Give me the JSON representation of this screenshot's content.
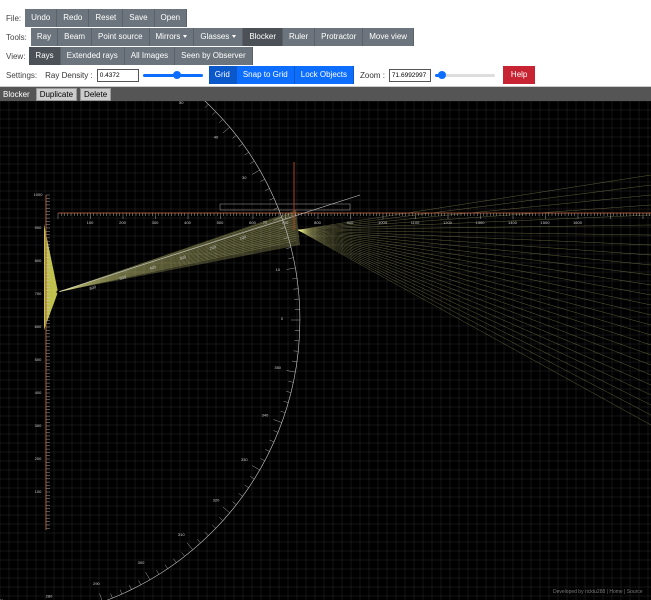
{
  "file_row": {
    "label": "File:",
    "buttons": [
      "Undo",
      "Redo",
      "Reset",
      "Save",
      "Open"
    ]
  },
  "tools_row": {
    "label": "Tools:",
    "ray": "Ray",
    "beam": "Beam",
    "point_source": "Point source",
    "mirrors": "Mirrors",
    "glasses": "Glasses",
    "blocker": "Blocker",
    "ruler": "Ruler",
    "protractor": "Protractor",
    "move_view": "Move view"
  },
  "view_row": {
    "label": "View:",
    "rays": "Rays",
    "extended_rays": "Extended rays",
    "all_images": "All Images",
    "seen_by_observer": "Seen by Observer"
  },
  "settings_row": {
    "label": "Settings:",
    "ray_density_label": "Ray Density :",
    "ray_density_value": "0.4372",
    "grid": "Grid",
    "snap_to_grid": "Snap to Grid",
    "lock_objects": "Lock Objects",
    "zoom_label": "Zoom :",
    "zoom_value": "71.6992997",
    "help": "Help"
  },
  "object_bar": {
    "name": "Blocker",
    "duplicate": "Duplicate",
    "delete": "Delete"
  },
  "footer": "Developed by ricktu288 | Home | Source",
  "ruler": {
    "ticks": [
      "100",
      "200",
      "300",
      "400",
      "500",
      "600",
      "700",
      "800",
      "900",
      "1000",
      "1100",
      "1200",
      "1300",
      "1400",
      "1500",
      "1600"
    ]
  },
  "vruler": {
    "ticks": [
      "1000",
      "900",
      "800",
      "700",
      "600",
      "500",
      "400",
      "300",
      "200",
      "100"
    ]
  },
  "diag_ruler": {
    "ticks": [
      "600",
      "500",
      "400",
      "300",
      "200",
      "100"
    ]
  },
  "protractor_labels": [
    "90",
    "80",
    "70",
    "60",
    "50",
    "40",
    "30",
    "20",
    "10",
    "0",
    "350",
    "340",
    "330",
    "320",
    "310",
    "300",
    "290",
    "280",
    "270",
    "260",
    "250"
  ],
  "colors": {
    "ray": "#ffff99",
    "grid": "#2a2a2a",
    "ruler": "#cccccc",
    "source": "#ffff66"
  }
}
